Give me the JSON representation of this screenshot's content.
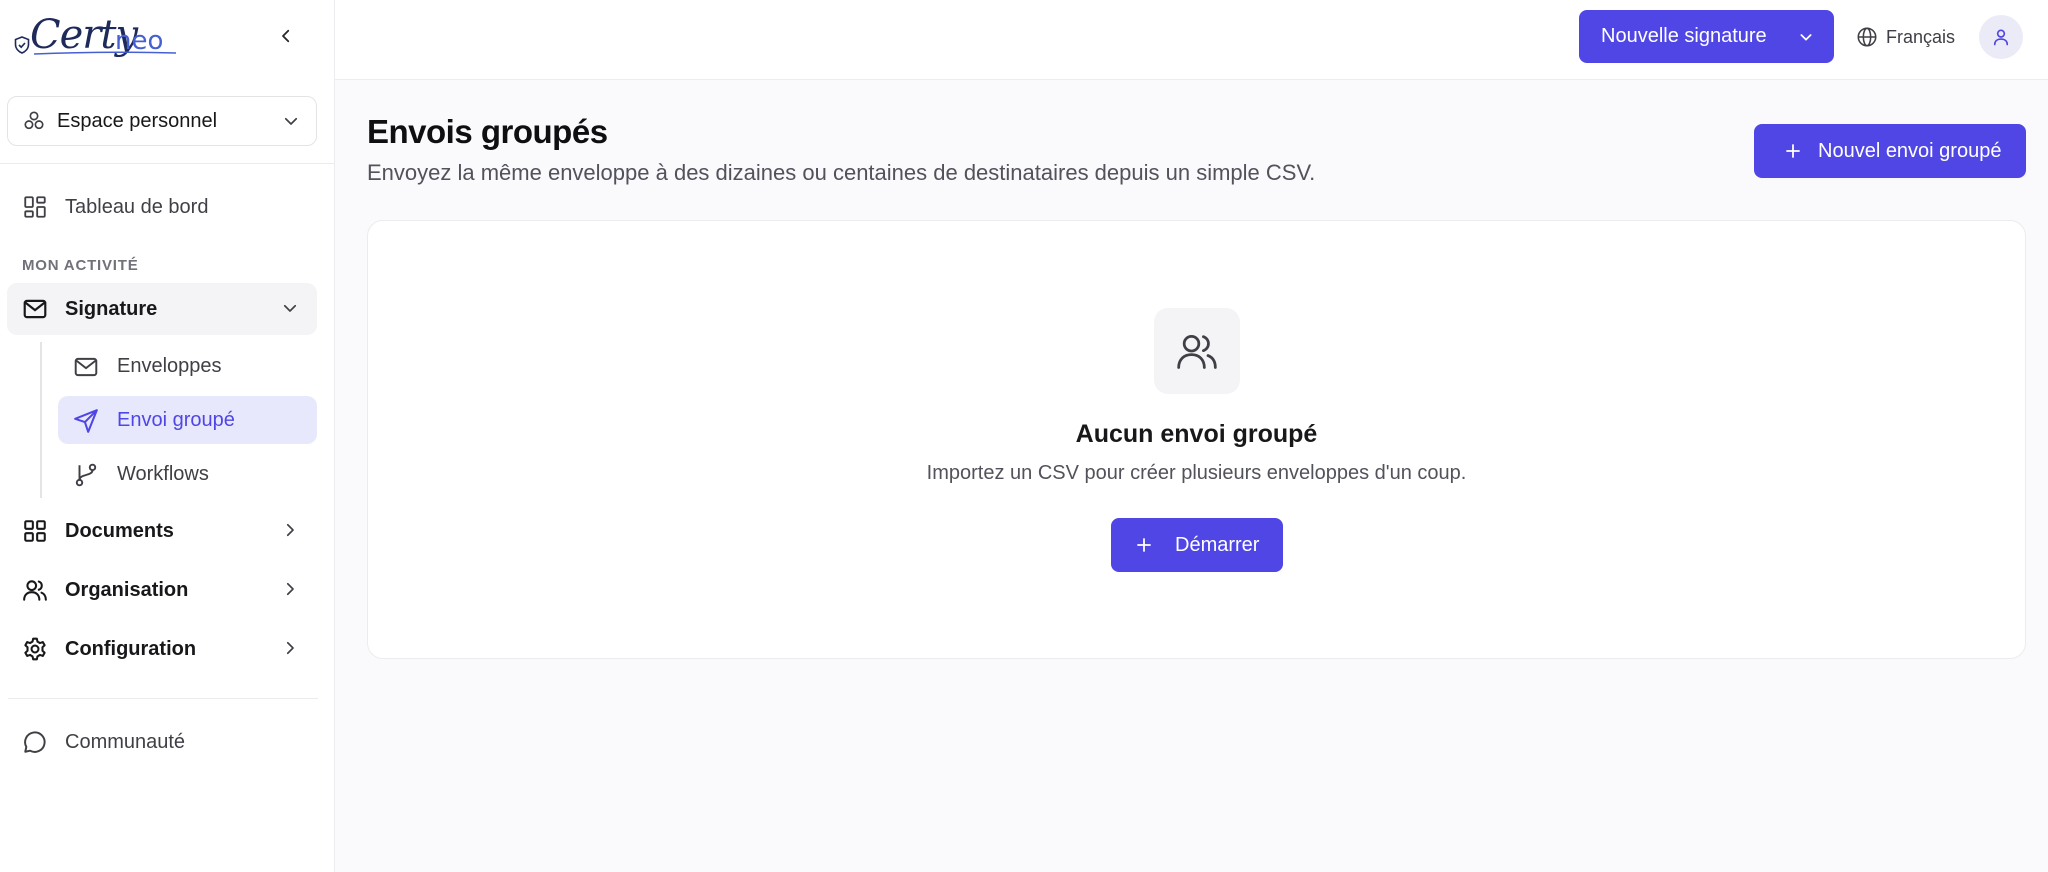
{
  "brand": {
    "logo_text_1": "Certy",
    "logo_text_2": "neo",
    "accent_color": "#4f46e5"
  },
  "sidebar": {
    "workspace_label": "Espace personnel",
    "dashboard_label": "Tableau de bord",
    "section_label": "MON ACTIVITÉ",
    "signature": {
      "label": "Signature",
      "children": [
        {
          "label": "Enveloppes",
          "icon": "mail-icon"
        },
        {
          "label": "Envoi groupé",
          "icon": "send-icon",
          "active": true
        },
        {
          "label": "Workflows",
          "icon": "git-branch-icon"
        }
      ]
    },
    "groups": [
      {
        "label": "Documents",
        "icon": "grid-icon"
      },
      {
        "label": "Organisation",
        "icon": "users-icon"
      },
      {
        "label": "Configuration",
        "icon": "gear-icon"
      }
    ],
    "community_label": "Communauté"
  },
  "topbar": {
    "new_signature_label": "Nouvelle signature",
    "language_label": "Français"
  },
  "main": {
    "title": "Envois groupés",
    "subtitle": "Envoyez la même enveloppe à des dizaines ou centaines de destinataires depuis un simple CSV.",
    "new_batch_label": "Nouvel envoi groupé",
    "empty_state": {
      "title": "Aucun envoi groupé",
      "text": "Importez un CSV pour créer plusieurs enveloppes d'un coup.",
      "button_label": "Démarrer"
    }
  }
}
